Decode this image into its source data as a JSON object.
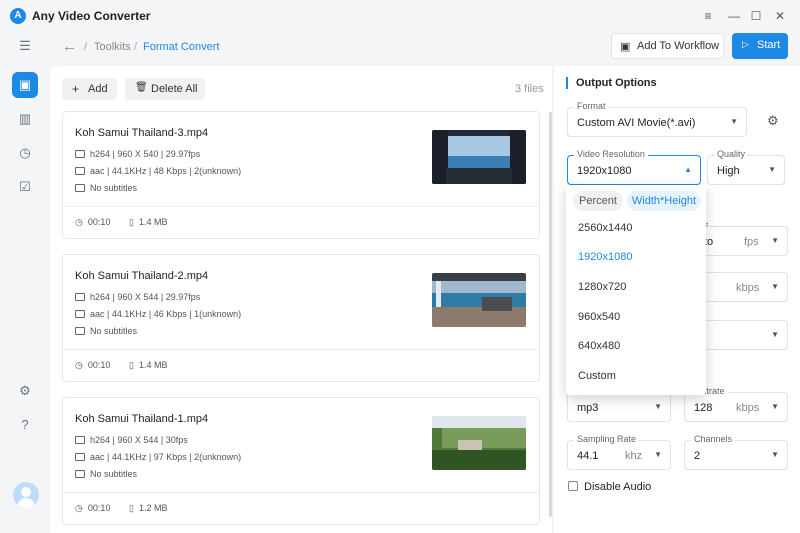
{
  "app": {
    "title": "Any Video Converter",
    "logo_letter": "A"
  },
  "window": {
    "menu": "≡",
    "minimize": "—",
    "maximize": "☐",
    "close": "✕"
  },
  "breadcrumb": {
    "root": "Toolkits",
    "current": "Format Convert",
    "separator": "/"
  },
  "toolbar": {
    "add_to_workflow": "Add To Workflow",
    "start": "Start",
    "add": "Add",
    "delete_all": "Delete All",
    "files_count": "3 files"
  },
  "files": [
    {
      "name": "Koh Samui Thailand-3.mp4",
      "video": "h264 | 960 X 540 | 29.97fps",
      "audio": "aac | 44.1KHz | 48 Kbps | 2(unknown)",
      "subtitles": "No subtitles",
      "duration": "00:10",
      "size": "1.4 MB"
    },
    {
      "name": "Koh Samui Thailand-2.mp4",
      "video": "h264 | 960 X 544 | 29.97fps",
      "audio": "aac | 44.1KHz | 46 Kbps | 1(unknown)",
      "subtitles": "No subtitles",
      "duration": "00:10",
      "size": "1.4 MB"
    },
    {
      "name": "Koh Samui Thailand-1.mp4",
      "video": "h264 | 960 X 544 | 30fps",
      "audio": "aac | 44.1KHz | 97 Kbps | 2(unknown)",
      "subtitles": "No subtitles",
      "duration": "00:10",
      "size": "1.2 MB"
    }
  ],
  "options": {
    "title": "Output Options",
    "format": {
      "label": "Format",
      "value": "Custom AVI Movie(*.avi)"
    },
    "resolution": {
      "label": "Video Resolution",
      "value": "1920x1080"
    },
    "quality": {
      "label": "Quality",
      "value": "High"
    },
    "partial": {
      "s": "s",
      "to": "to",
      "fps": "fps",
      "kbps": "kbps",
      "audio_bitrate": "dio Bitrate"
    },
    "audio_codec": {
      "value": "mp3"
    },
    "audio_bitrate": {
      "value": "128",
      "unit": "kbps"
    },
    "sampling_rate": {
      "label": "Sampling Rate",
      "value": "44.1",
      "unit": "khz"
    },
    "channels": {
      "label": "Channels",
      "value": "2"
    },
    "disable_audio": "Disable Audio"
  },
  "resolution_dropdown": {
    "tabs": [
      "Percent",
      "Width*Height"
    ],
    "items": [
      "2560x1440",
      "1920x1080",
      "1280x720",
      "960x540",
      "640x480",
      "Custom"
    ],
    "selected": "1920x1080"
  },
  "colors": {
    "accent": "#1e88e5"
  }
}
